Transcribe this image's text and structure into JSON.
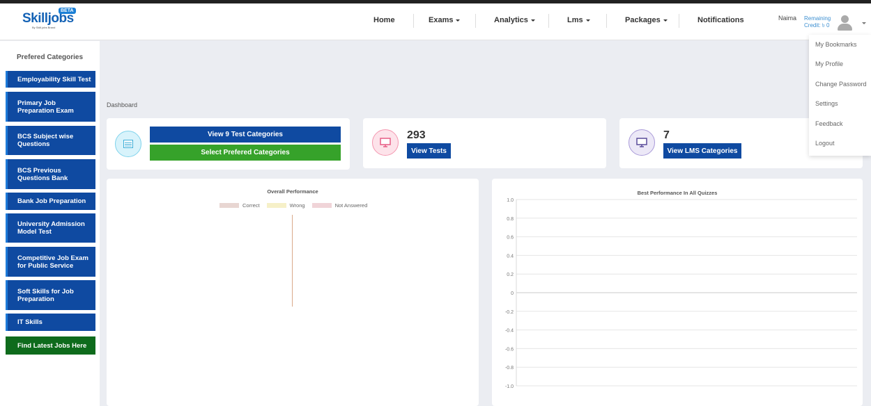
{
  "brand": {
    "name_a": "Skill",
    "name_b": "jobs",
    "badge": "BETA",
    "tagline": "By Skill.jobs Brand"
  },
  "nav": {
    "items": [
      {
        "label": "Home",
        "dropdown": false
      },
      {
        "label": "Exams",
        "dropdown": true
      },
      {
        "label": "Analytics",
        "dropdown": true
      },
      {
        "label": "Lms",
        "dropdown": true
      },
      {
        "label": "Packages",
        "dropdown": true
      },
      {
        "label": "Notifications",
        "dropdown": false
      }
    ]
  },
  "user": {
    "name": "Naima",
    "credit_line1": "Remaining",
    "credit_line2": "Credit: ৳ 0"
  },
  "user_menu": [
    "My Bookmarks",
    "My Profile",
    "Change Password",
    "Settings",
    "Feedback",
    "Logout"
  ],
  "sidebar": {
    "heading": "Prefered Categories",
    "items": [
      "Employability Skill Test",
      "Primary Job Preparation Exam",
      "BCS Subject wise Questions",
      "BCS Previous Questions Bank",
      "Bank Job Preparation",
      "University Admission Model Test",
      "Competitive Job Exam for Public Service",
      "Soft Skills for Job Preparation",
      "IT Skills",
      "Find Latest Jobs Here"
    ]
  },
  "breadcrumb": "Dashboard",
  "cards": {
    "categories": {
      "btn_view": "View 9 Test Categories",
      "btn_select": "Select Prefered Categories"
    },
    "tests": {
      "count": "293",
      "btn": "View Tests"
    },
    "lms": {
      "count": "7",
      "btn": "View LMS Categories"
    }
  },
  "colors": {
    "primary": "#0f4aa1",
    "green": "#36a22a",
    "dark_green": "#0e6b1c"
  },
  "chart_data": [
    {
      "type": "pie",
      "title": "Overall Performance",
      "legend": [
        {
          "label": "Correct",
          "color": "#e8d6d2"
        },
        {
          "label": "Wrong",
          "color": "#f6f0c8"
        },
        {
          "label": "Not Answered",
          "color": "#f0d4d8"
        }
      ],
      "values": [
        0,
        0,
        0
      ]
    },
    {
      "type": "line",
      "title": "Best Performance In All Quizzes",
      "yticks": [
        "1.0",
        "0.8",
        "0.6",
        "0.4",
        "0.2",
        "0",
        "-0.2",
        "-0.4",
        "-0.6",
        "-0.8",
        "-1.0"
      ],
      "ylim": [
        -1.0,
        1.0
      ],
      "series": []
    }
  ]
}
